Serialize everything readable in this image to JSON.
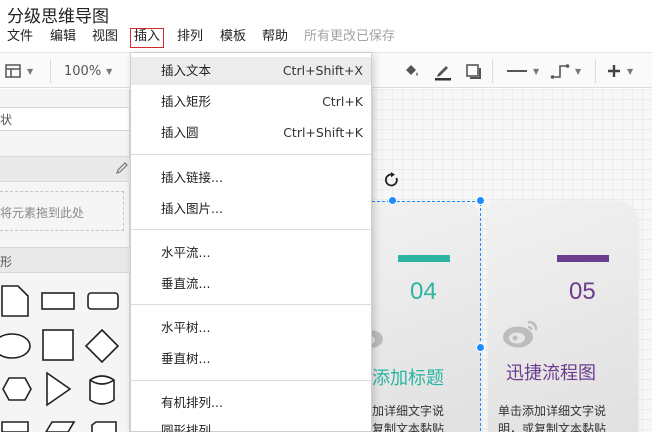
{
  "app": {
    "title": "分级思维导图"
  },
  "menubar": {
    "items": [
      {
        "label": "文件"
      },
      {
        "label": "编辑"
      },
      {
        "label": "视图"
      },
      {
        "label": "插入"
      },
      {
        "label": "排列"
      },
      {
        "label": "模板"
      },
      {
        "label": "帮助"
      }
    ],
    "save_status": "所有更改已保存"
  },
  "toolbar": {
    "zoom": "100%"
  },
  "sidebar": {
    "search_placeholder": "状",
    "drop_hint": "将元素拖到此处",
    "section_label": "形"
  },
  "insert_menu": {
    "groups": [
      [
        {
          "label": "插入文本",
          "shortcut": "Ctrl+Shift+X"
        },
        {
          "label": "插入矩形",
          "shortcut": "Ctrl+K"
        },
        {
          "label": "插入圆",
          "shortcut": "Ctrl+Shift+K"
        }
      ],
      [
        {
          "label": "插入链接..."
        },
        {
          "label": "插入图片..."
        }
      ],
      [
        {
          "label": "水平流..."
        },
        {
          "label": "垂直流..."
        }
      ],
      [
        {
          "label": "水平树..."
        },
        {
          "label": "垂直树..."
        }
      ],
      [
        {
          "label": "有机排列..."
        },
        {
          "label": "圆形排列"
        }
      ]
    ]
  },
  "canvas": {
    "cards": [
      {
        "number": "04",
        "title": "添加标题",
        "desc_lines": [
          "加详细文字说",
          "复制文本黏贴"
        ],
        "accent": "#2bb5a2"
      },
      {
        "number": "05",
        "title": "迅捷流程图",
        "desc_lines": [
          "单击添加详细文字说",
          "明，或复制文本黏贴"
        ],
        "accent": "#6c3c8f"
      }
    ]
  },
  "colors": {
    "active_menu_border": "#d42a2a",
    "selection_handle": "#1a8cff"
  }
}
